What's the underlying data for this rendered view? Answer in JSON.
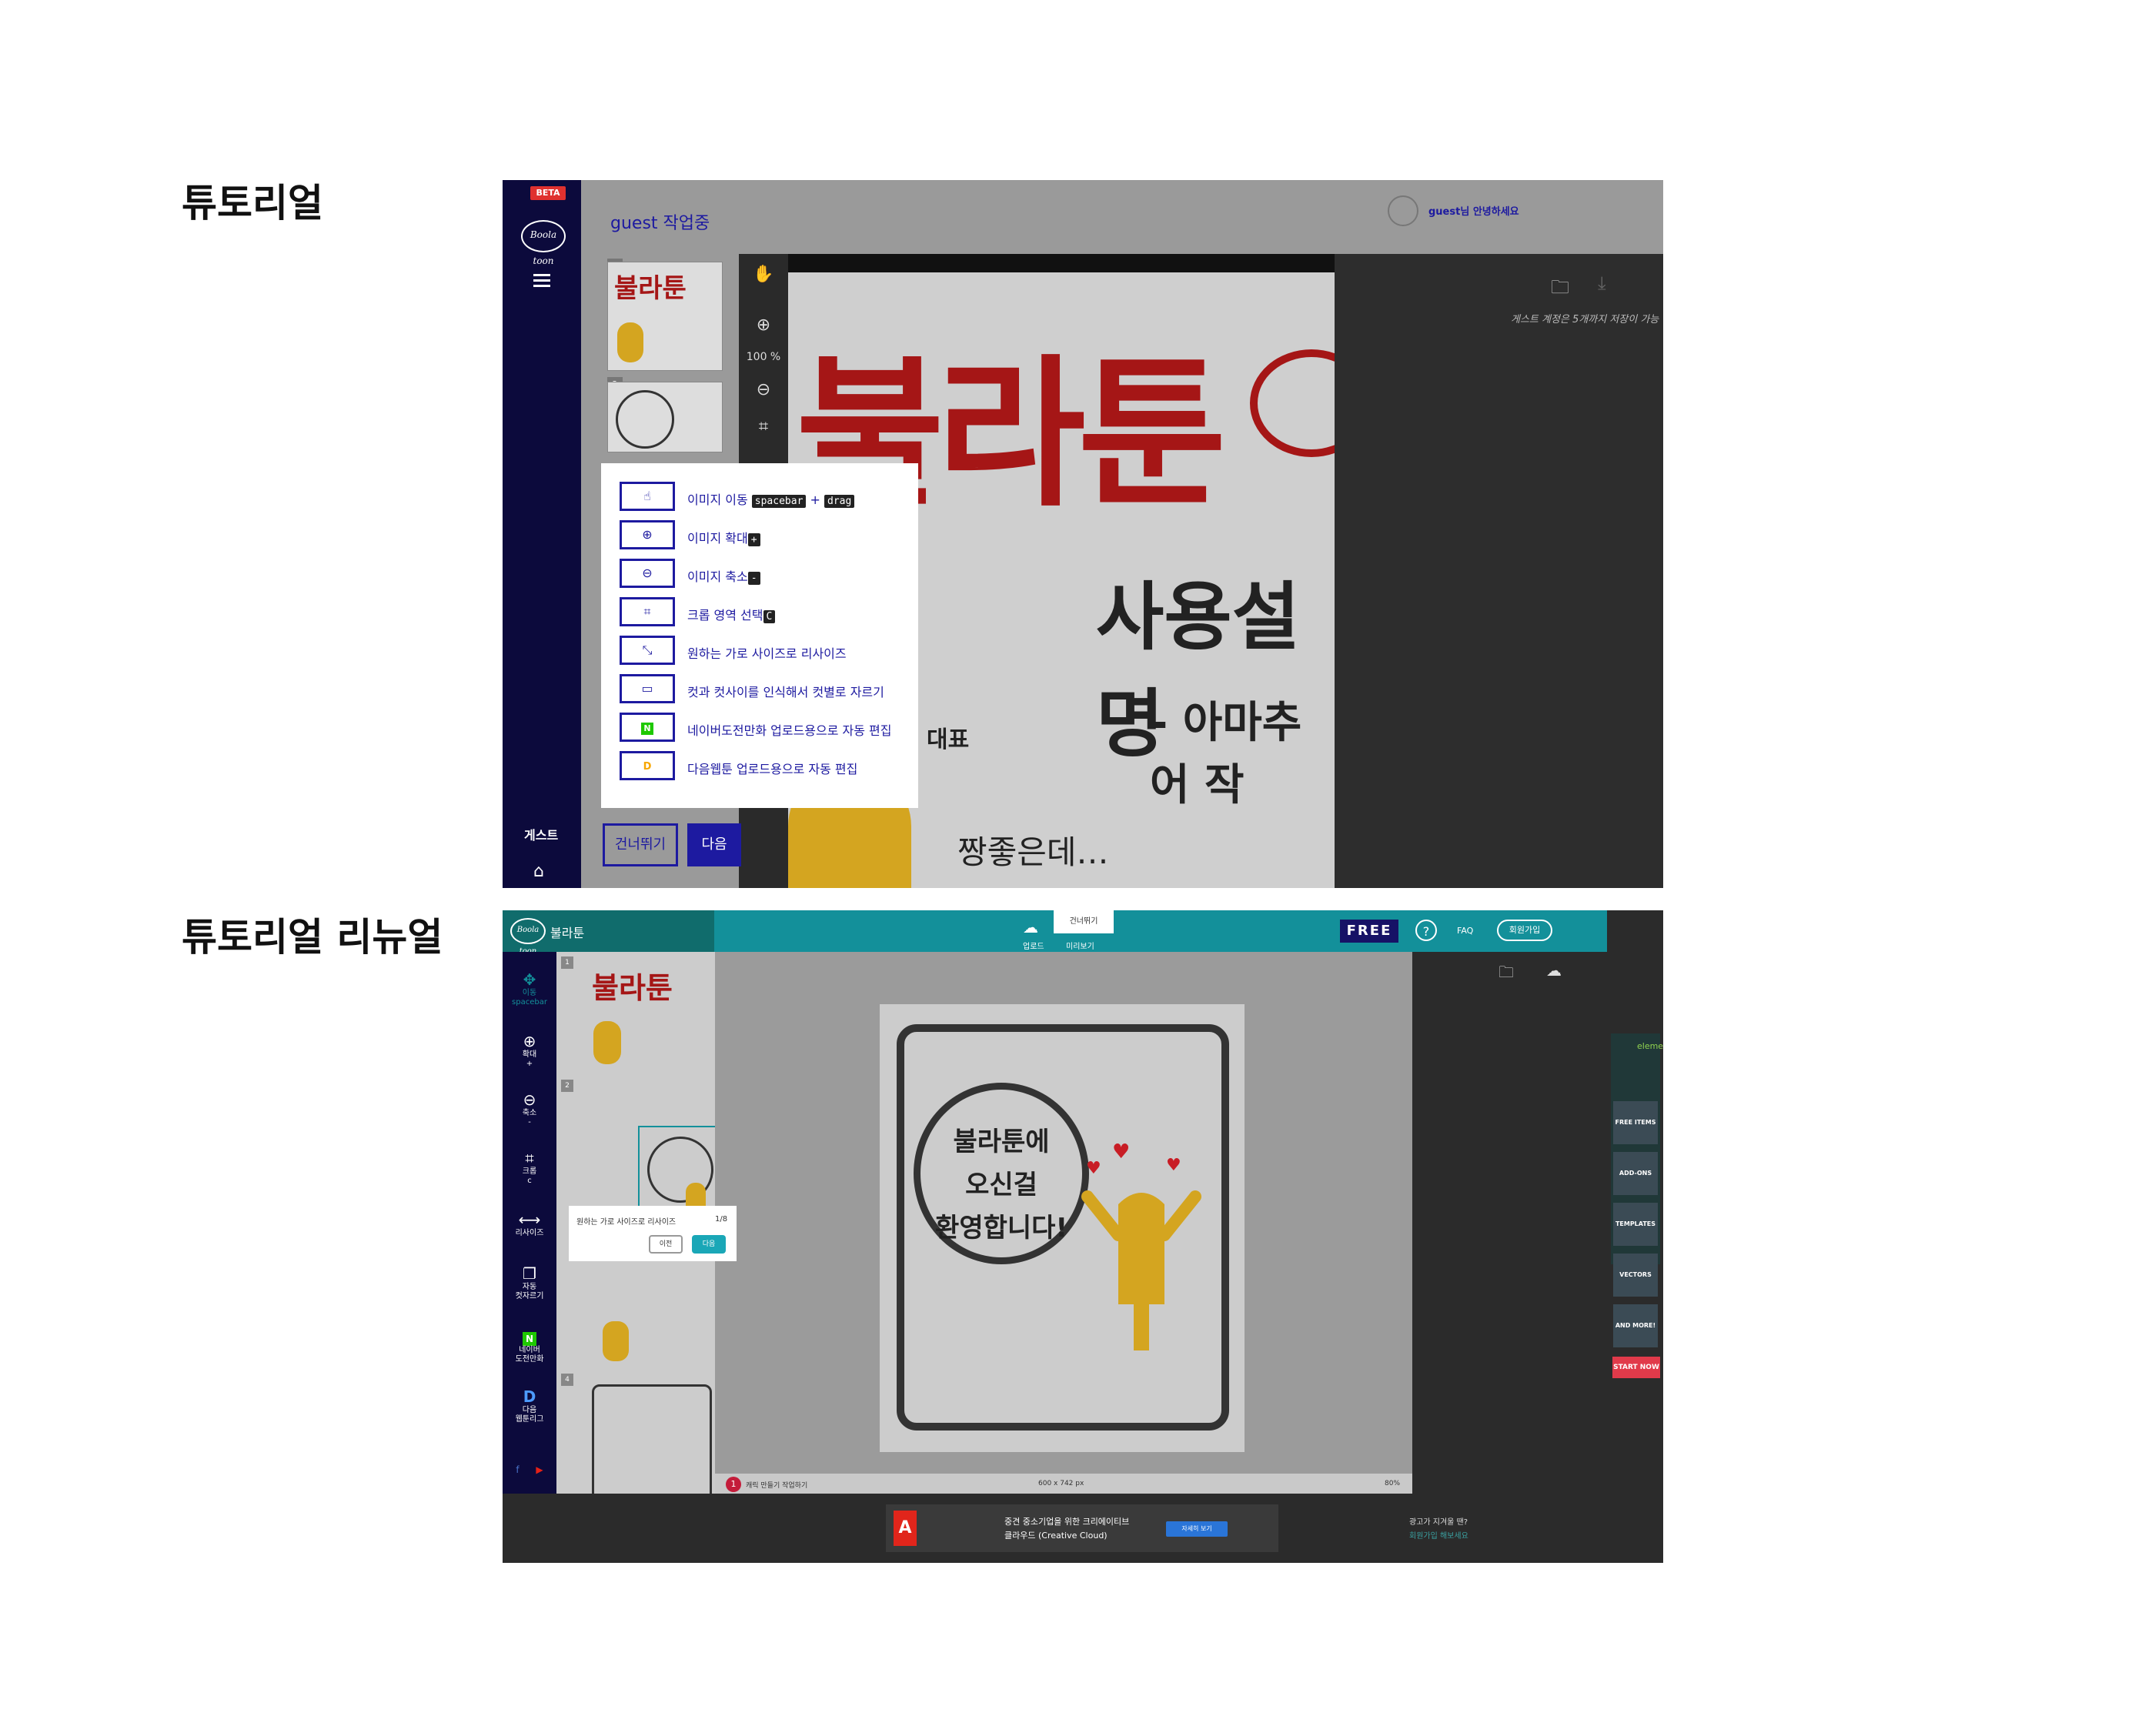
{
  "headings": {
    "tutorial": "튜토리얼",
    "tutorial_renewal": "튜토리얼 리뉴얼"
  },
  "s1": {
    "beta": "BETA",
    "logo": "Boola toon",
    "work_title": "guest 작업중",
    "greeting": "guest님 안녕하세요",
    "guest": "게스트",
    "zoom": "100 %",
    "note": "게스트 계정은 5개까지 저장이 가능",
    "canvas_title": "불라툰",
    "canvas_subtitle": "사용설명",
    "canvas_line3": "- 아마추어 작",
    "canvas_line4": "짱좋은데…",
    "canvas_rep": "대표",
    "tutorial_items": [
      {
        "icon": "hand-icon",
        "text": "이미지 이동",
        "keys": [
          "spacebar",
          "drag"
        ],
        "sep": "+"
      },
      {
        "icon": "zoom-in-icon",
        "text": "이미지 확대",
        "keys": [
          "+"
        ]
      },
      {
        "icon": "zoom-out-icon",
        "text": "이미지 축소",
        "keys": [
          "-"
        ]
      },
      {
        "icon": "crop-icon",
        "text": "크롭 영역 선택",
        "keys": [
          "C"
        ]
      },
      {
        "icon": "resize-icon",
        "text": "원하는 가로 사이즈로 리사이즈",
        "keys": []
      },
      {
        "icon": "cut-icon",
        "text": "컷과 컷사이를 인식해서 컷별로 자르기",
        "keys": []
      },
      {
        "icon": "naver-icon",
        "text": "네이버도전만화 업로드용으로 자동 편집",
        "keys": []
      },
      {
        "icon": "daum-icon",
        "text": "다음웹툰 업로드용으로 자동 편집",
        "keys": []
      }
    ],
    "skip": "건너뛰기",
    "next": "다음"
  },
  "s2": {
    "app_name": "불라툰",
    "logo": "Boola toon",
    "upload": "업로드",
    "tip": "건너뛰기",
    "preview": "미리보기",
    "free": "FREE",
    "help": "?",
    "faq": "FAQ",
    "signup": "회원가입",
    "tools": [
      {
        "icon": "move-icon",
        "label": "이동",
        "sub": "spacebar"
      },
      {
        "icon": "zoom-in-icon",
        "label": "확대",
        "sub": "+"
      },
      {
        "icon": "zoom-out-icon",
        "label": "축소",
        "sub": "-"
      },
      {
        "icon": "crop-icon",
        "label": "크롭",
        "sub": "c"
      },
      {
        "icon": "resize-icon",
        "label": "리사이즈",
        "sub": ""
      },
      {
        "icon": "cut-icon",
        "label": "자동",
        "sub": "컷자르기"
      },
      {
        "icon": "naver-icon",
        "label": "네이버",
        "sub": "도전만화"
      },
      {
        "icon": "daum-icon",
        "label": "다음",
        "sub": "웹툰리그"
      }
    ],
    "bubble": [
      "불라툰에",
      "오신걸",
      "환영합니다!"
    ],
    "status_num": "1",
    "status_label": "캐릭 만들기 작업하기",
    "status_size": "600 x 742 px",
    "status_zoom": "80%",
    "popup_text": "원하는 가로 사이즈로 리사이즈",
    "popup_page": "1/8",
    "popup_prev": "이전",
    "popup_next": "다음",
    "ad_side": [
      "FREE ITEMS",
      "ADD-ONS",
      "TEMPLATES",
      "VECTORS",
      "AND MORE!"
    ],
    "ad_side_start": "START NOW",
    "ad_side_brand": "elements",
    "ad_banner_line1": "중견 중소기업을 위한 크리에이티브",
    "ad_banner_line2": "클라우드 (Creative Cloud)",
    "ad_banner_btn": "자세히 보기",
    "ad_q1": "광고가 지겨울 땐?",
    "ad_q2": "회원가입 해보세요"
  }
}
